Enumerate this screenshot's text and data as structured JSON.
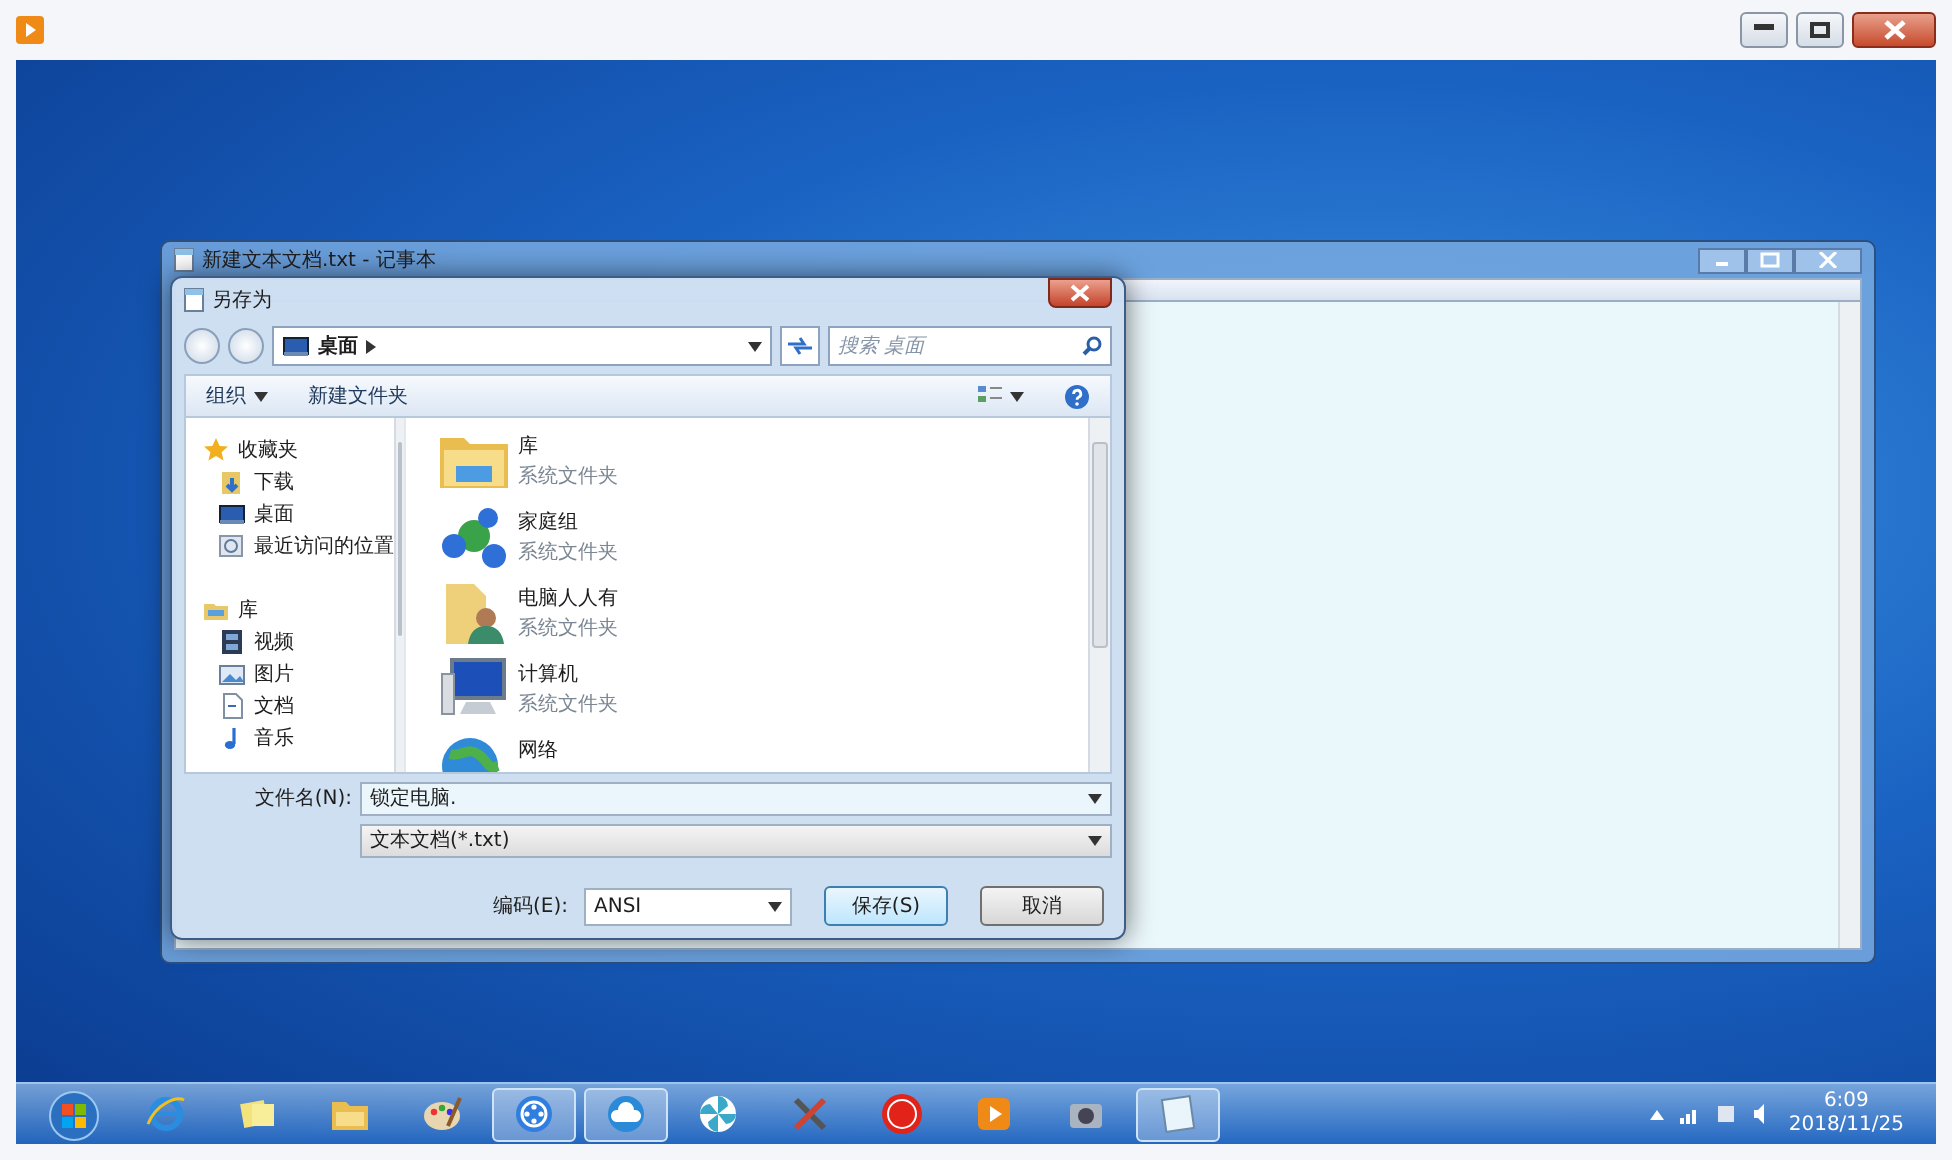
{
  "notepad": {
    "title": "新建文本文档.txt - 记事本"
  },
  "dialog": {
    "title": "另存为",
    "address": {
      "segments": [
        "桌面"
      ]
    },
    "search": {
      "placeholder": "搜索 桌面"
    },
    "toolbar": [
      {
        "label": "组织",
        "kind": "menu"
      },
      {
        "label": "新建文件夹",
        "kind": "plain"
      }
    ],
    "nav": [
      {
        "label": "收藏夹",
        "kind": "star",
        "children": [
          {
            "label": "下载",
            "kind": "download"
          },
          {
            "label": "桌面",
            "kind": "desktop"
          },
          {
            "label": "最近访问的位置",
            "kind": "recent"
          }
        ]
      },
      {
        "label": "库",
        "kind": "library",
        "children": [
          {
            "label": "视频",
            "kind": "video"
          },
          {
            "label": "图片",
            "kind": "picture"
          },
          {
            "label": "文档",
            "kind": "document"
          },
          {
            "label": "音乐",
            "kind": "music"
          }
        ]
      }
    ],
    "items": [
      {
        "name": "库",
        "type": "系统文件夹",
        "kind": "library"
      },
      {
        "name": "家庭组",
        "type": "系统文件夹",
        "kind": "homegroup"
      },
      {
        "name": "电脑人人有",
        "type": "系统文件夹",
        "kind": "user"
      },
      {
        "name": "计算机",
        "type": "系统文件夹",
        "kind": "computer"
      },
      {
        "name": "网络",
        "kind": "network"
      }
    ],
    "filename": {
      "label": "文件名(N):",
      "value": "锁定电脑."
    },
    "filetype": {
      "value": "文本文档(*.txt)"
    },
    "encoding": {
      "label": "编码(E):",
      "value": "ANSI"
    },
    "buttons": [
      {
        "label": "保存(S)",
        "default": true
      },
      {
        "label": "取消",
        "default": false
      }
    ]
  },
  "taskbar": {
    "apps": [
      {
        "kind": "ie",
        "active": false
      },
      {
        "kind": "notes",
        "active": false
      },
      {
        "kind": "explorer",
        "active": false
      },
      {
        "kind": "paint",
        "active": false
      },
      {
        "kind": "video",
        "active": true
      },
      {
        "kind": "cloud",
        "active": true
      },
      {
        "kind": "pinwheel",
        "active": false
      },
      {
        "kind": "tools",
        "active": false
      },
      {
        "kind": "chess",
        "active": false
      },
      {
        "kind": "player",
        "active": false
      },
      {
        "kind": "camera",
        "active": false
      },
      {
        "kind": "notepad",
        "active": true
      }
    ],
    "time": "6:09",
    "date": "2018/11/25"
  }
}
